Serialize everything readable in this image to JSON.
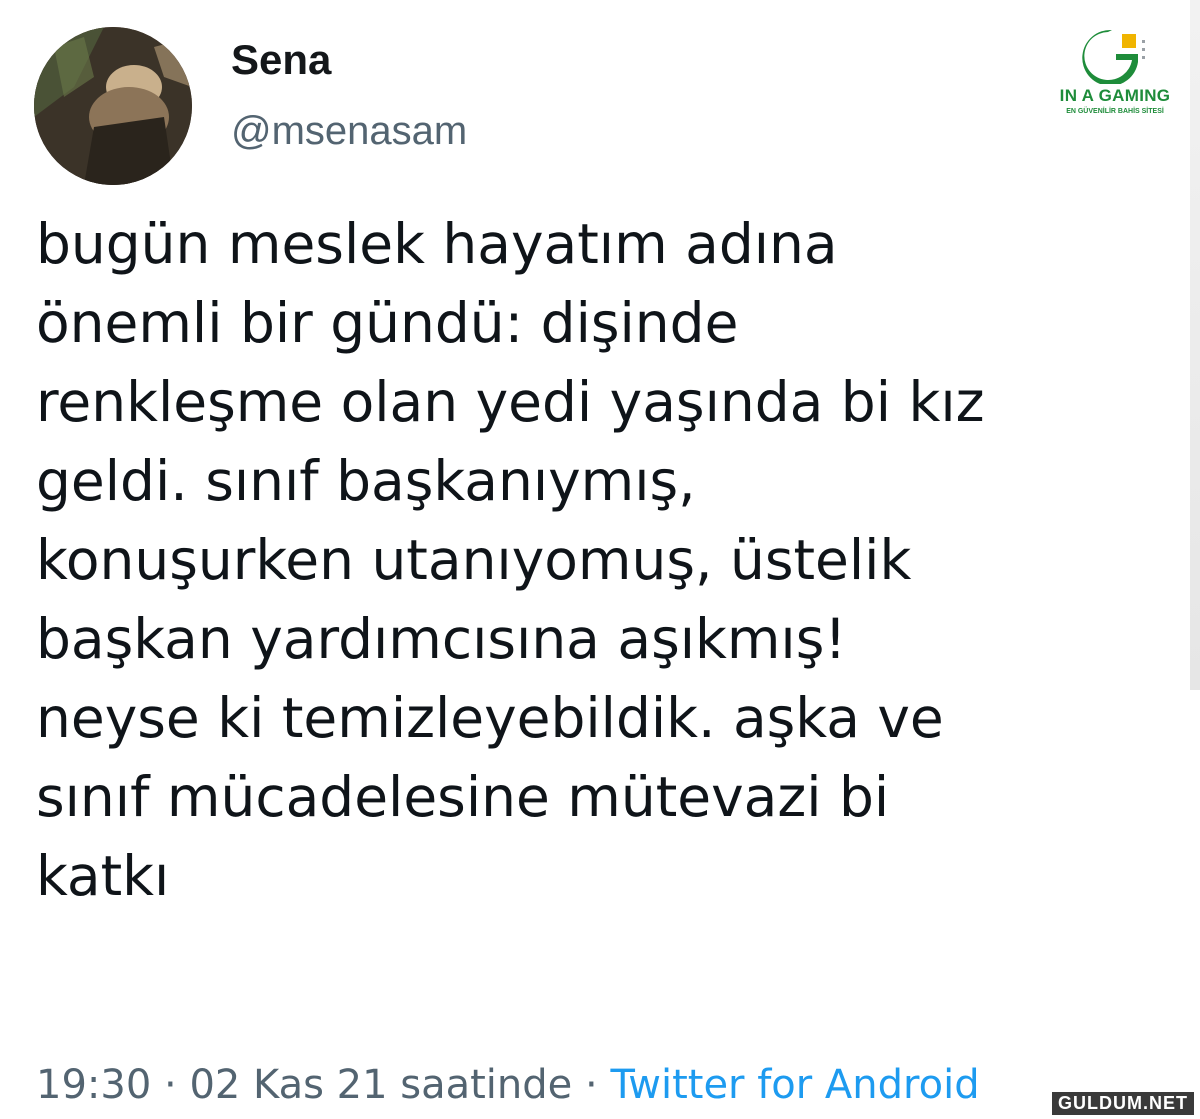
{
  "tweet": {
    "display_name": "Sena",
    "handle": "@msenasam",
    "lines": [
      "bugün meslek hayatım adına",
      "önemli bir gündü: dişinde",
      "renkleşme olan yedi yaşında bi kız",
      "geldi. sınıf başkanıymış,",
      "konuşurken utanıyomuş, üstelik",
      "başkan yardımcısına aşıkmış!",
      "neyse ki temizleyebildik. aşka ve",
      "sınıf mücadelesine mütevazi bi",
      "katkı"
    ],
    "time": "19:30",
    "separator": "·",
    "date": "02 Kas 21 saatinde",
    "source": "Twitter for Android"
  },
  "logo": {
    "name": "IN A GAMING",
    "tagline": "EN GÜVENİLİR BAHİS SİTESİ",
    "color": "#1e8c3a",
    "accent": "#f0b400"
  },
  "watermark": {
    "text": "GULDUM.NET"
  },
  "colors": {
    "text": "#0f1419",
    "muted": "#536471",
    "link": "#1d9bf0"
  }
}
